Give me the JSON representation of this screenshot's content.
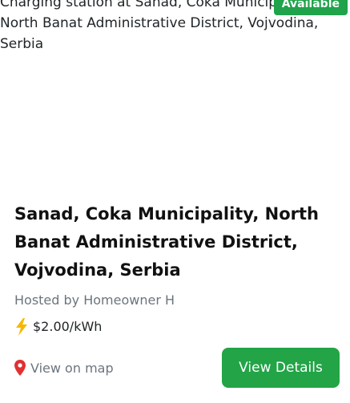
{
  "listing": {
    "image_alt": "Charging station at Sanad, Coka Municipality, North Banat Administrative District, Vojvodina, Serbia",
    "status_badge": "Available",
    "title": "Sanad, Coka Municipality, North Banat Administrative District, Vojvodina, Serbia",
    "host": "Hosted by Homeowner H",
    "price": "$2.00/kWh",
    "map_link": "View on map",
    "details_button": "View Details"
  },
  "icons": {
    "price": "lightning-bolt-icon",
    "map": "map-pin-icon"
  },
  "colors": {
    "badge": "#20a34a",
    "button": "#22a447",
    "pin": "#e03131",
    "bolt": "#f5b800"
  }
}
